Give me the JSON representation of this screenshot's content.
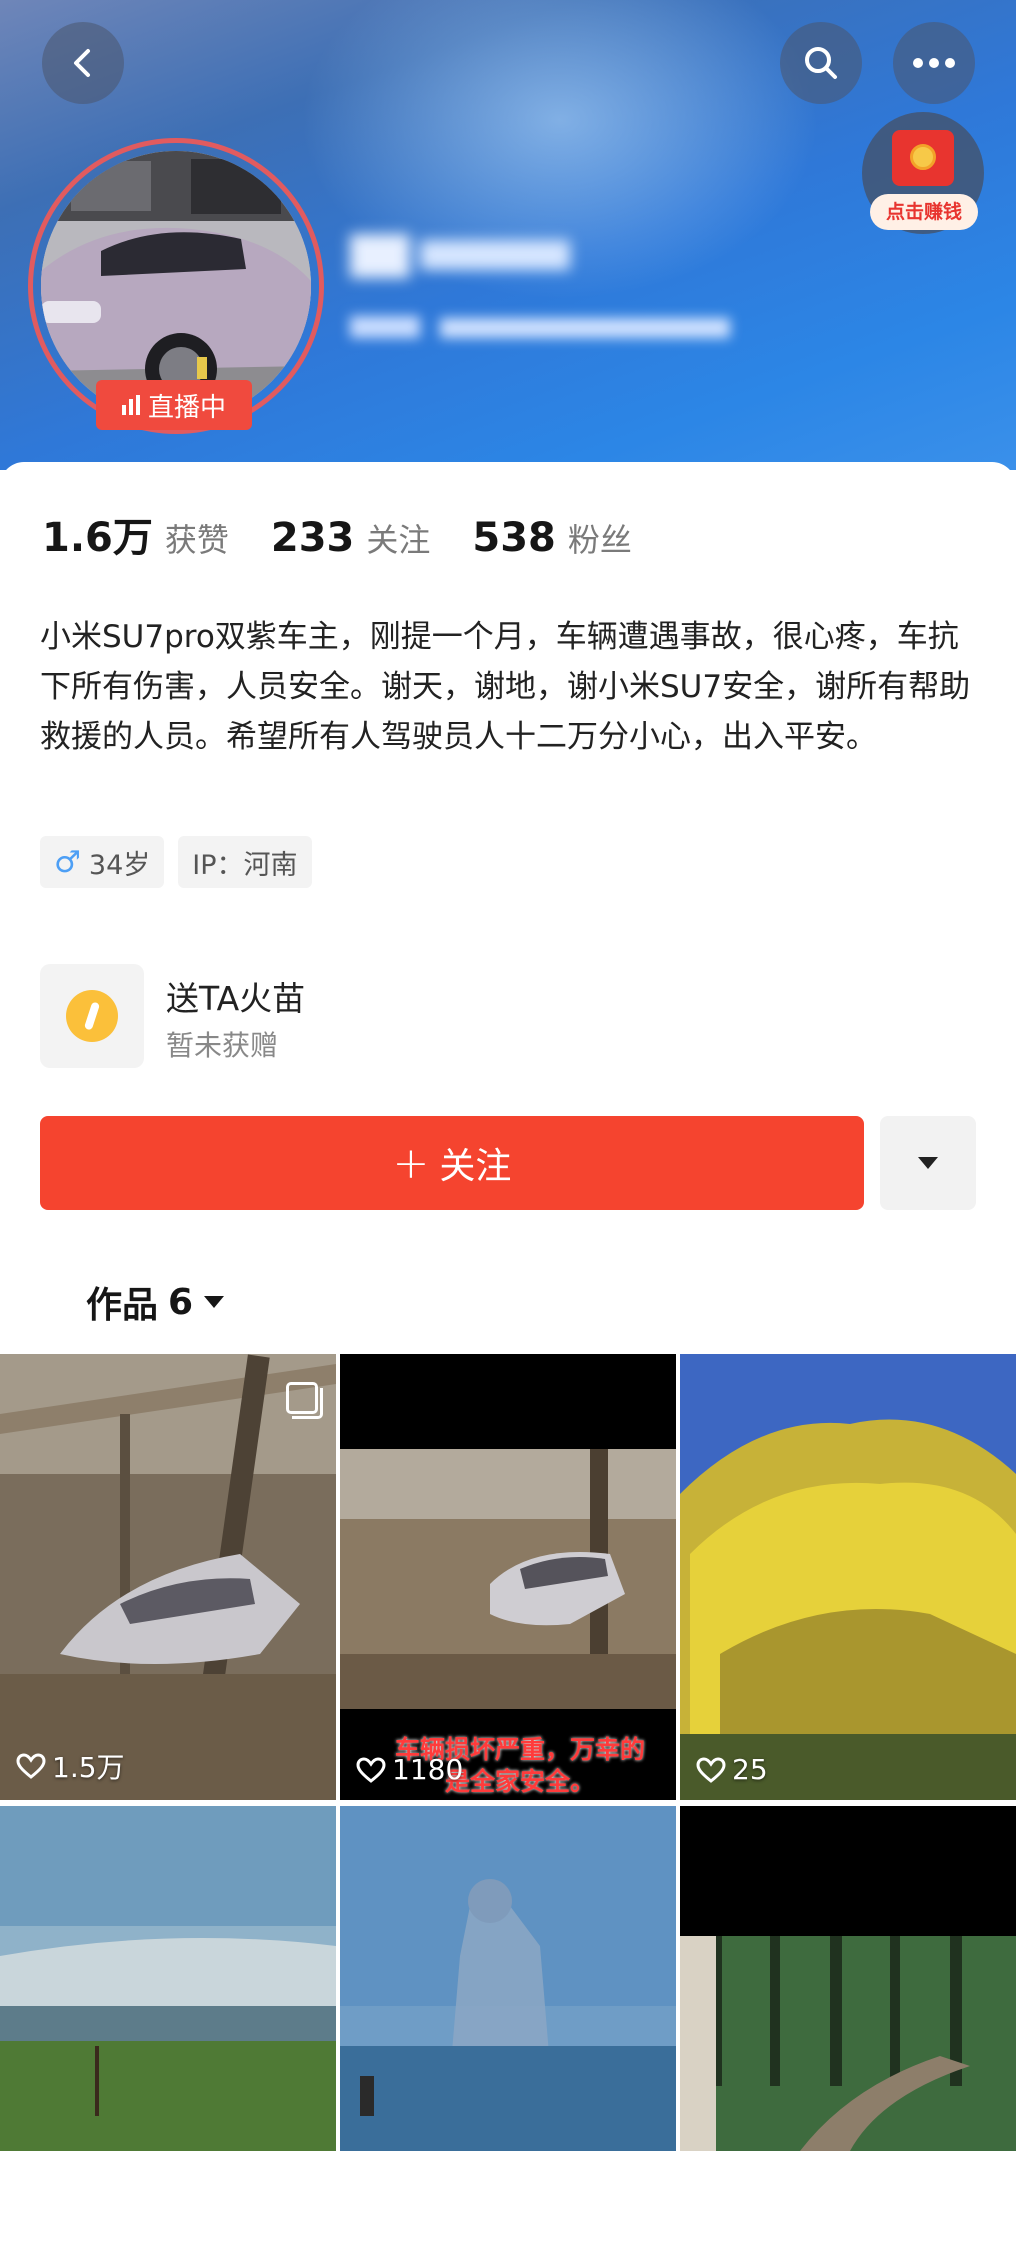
{
  "header": {
    "live_badge": "直播中",
    "reward_label": "点击赚钱",
    "icons": {
      "back": "back-arrow-icon",
      "search": "search-icon",
      "more": "more-dots-icon",
      "reward": "red-envelope-icon"
    }
  },
  "stats": {
    "likes_value": "1.6万",
    "likes_label": "获赞",
    "following_value": "233",
    "following_label": "关注",
    "followers_value": "538",
    "followers_label": "粉丝"
  },
  "bio": "小米SU7pro双紫车主，刚提一个月，车辆遭遇事故，很心疼，车抗下所有伤害，人员安全。谢天，谢地，谢小米SU7安全，谢所有帮助救援的人员。希望所有人驾驶员人十二万分小心，出入平安。",
  "tags": {
    "gender_symbol": "♂",
    "age": "34岁",
    "ip": "IP：河南"
  },
  "gift": {
    "title": "送TA火苗",
    "subtitle": "暂未获赠"
  },
  "actions": {
    "follow_plus": "+",
    "follow_label": "关注"
  },
  "works": {
    "label": "作品",
    "count": "6"
  },
  "grid": [
    {
      "likes": "1.5万",
      "caption": ""
    },
    {
      "likes": "1180",
      "caption": "车辆损坏严重，万幸的是全家安全。"
    },
    {
      "likes": "25",
      "caption": ""
    },
    {
      "likes": "",
      "caption": ""
    },
    {
      "likes": "",
      "caption": ""
    },
    {
      "likes": "",
      "caption": ""
    }
  ],
  "colors": {
    "accent": "#f5442f",
    "live_ring": "#e15b5f",
    "header_blue": "#2f78d8"
  }
}
